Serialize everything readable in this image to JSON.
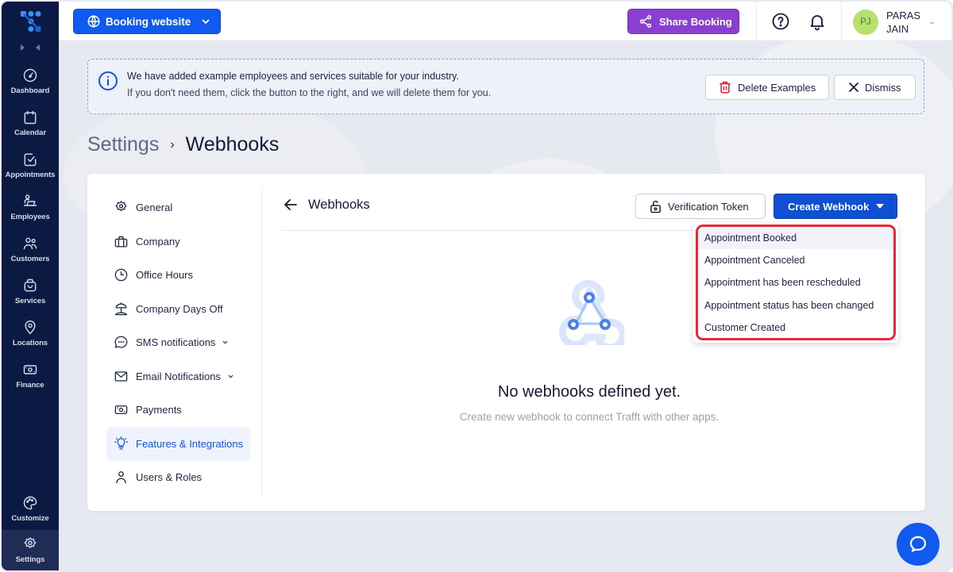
{
  "nav": {
    "items": [
      {
        "label": "Dashboard",
        "icon": "gauge-icon"
      },
      {
        "label": "Calendar",
        "icon": "calendar-icon"
      },
      {
        "label": "Appointments",
        "icon": "checkbox-icon"
      },
      {
        "label": "Employees",
        "icon": "employee-desk-icon"
      },
      {
        "label": "Customers",
        "icon": "users-icon"
      },
      {
        "label": "Services",
        "icon": "basket-icon"
      },
      {
        "label": "Locations",
        "icon": "map-pin-icon"
      },
      {
        "label": "Finance",
        "icon": "banknote-icon"
      },
      {
        "label": "Customize",
        "icon": "palette-icon"
      },
      {
        "label": "Settings",
        "icon": "gear-icon",
        "active": true
      }
    ]
  },
  "topbar": {
    "booking_label": "Booking website",
    "share_label": "Share Booking",
    "user": {
      "initials": "PJ",
      "name": "PARAS JAIN"
    }
  },
  "alert": {
    "line1": "We have added example employees and services suitable for your industry.",
    "line2": "If you don't need them, click the button to the right, and we will delete them for you.",
    "delete_label": "Delete Examples",
    "dismiss_label": "Dismiss"
  },
  "breadcrumb": {
    "parent": "Settings",
    "separator": "›",
    "current": "Webhooks"
  },
  "settings_menu": {
    "items": [
      {
        "label": "General",
        "icon": "gear-icon"
      },
      {
        "label": "Company",
        "icon": "briefcase-icon"
      },
      {
        "label": "Office Hours",
        "icon": "clock-icon"
      },
      {
        "label": "Company Days Off",
        "icon": "beach-umbrella-icon"
      },
      {
        "label": "SMS notifications",
        "icon": "chat-bubble-icon",
        "expandable": true
      },
      {
        "label": "Email Notifications",
        "icon": "envelope-icon",
        "expandable": true
      },
      {
        "label": "Payments",
        "icon": "banknote-icon"
      },
      {
        "label": "Features & Integrations",
        "icon": "lightbulb-icon",
        "active": true
      },
      {
        "label": "Users & Roles",
        "icon": "user-icon"
      }
    ]
  },
  "panel": {
    "title": "Webhooks",
    "token_label": "Verification Token",
    "create_label": "Create Webhook",
    "dropdown_options": [
      "Appointment Booked",
      "Appointment Canceled",
      "Appointment has been rescheduled",
      "Appointment status has been changed",
      "Customer Created"
    ],
    "empty_title": "No webhooks defined yet.",
    "empty_subtitle": "Create new webhook to connect Trafft with other apps."
  },
  "colors": {
    "nav_bg": "#0b1a43",
    "primary": "#0f5bf0",
    "share": "#8a3fd1",
    "highlight": "#e8293c"
  }
}
